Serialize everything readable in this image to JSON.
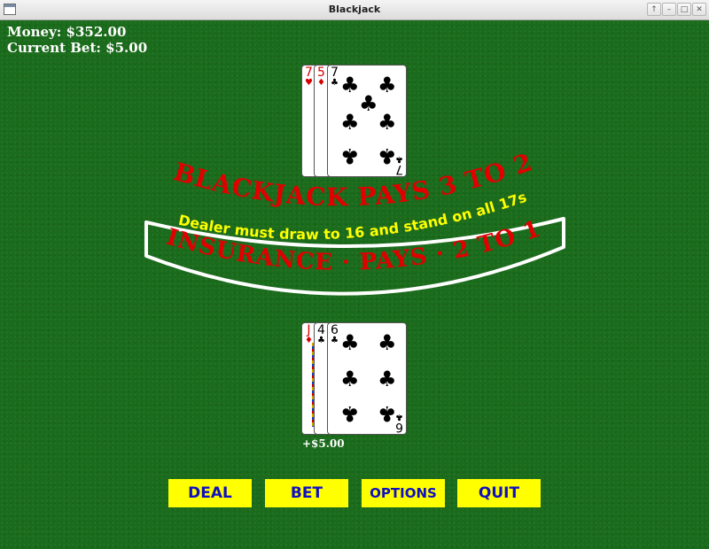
{
  "window": {
    "title": "Blackjack"
  },
  "stats": {
    "money": "Money: $352.00",
    "current_bet": "Current Bet: $5.00"
  },
  "table_text": {
    "main": "BLACKJACK PAYS 3 TO 2",
    "rule": "Dealer must draw to 16 and stand on all 17s",
    "insurance": "INSURANCE · PAYS · 2 TO 1"
  },
  "dealer_hand": [
    {
      "rank": "7",
      "suit": "♥",
      "color": "red"
    },
    {
      "rank": "5",
      "suit": "♦",
      "color": "red"
    },
    {
      "rank": "7",
      "suit": "♣",
      "color": "black"
    }
  ],
  "player_hand": [
    {
      "rank": "J",
      "suit": "♦",
      "color": "red"
    },
    {
      "rank": "4",
      "suit": "♣",
      "color": "black"
    },
    {
      "rank": "6",
      "suit": "♣",
      "color": "black"
    }
  ],
  "player_bet": "+$5.00",
  "buttons": {
    "deal": "DEAL",
    "bet": "BET",
    "options": "OPTIONS",
    "quit": "QUIT"
  },
  "colors": {
    "felt": "#1a6b1b",
    "button_bg": "#ffff00",
    "button_text": "#1010c0",
    "arc_red": "#e00000",
    "arc_yellow": "#ffff00"
  }
}
